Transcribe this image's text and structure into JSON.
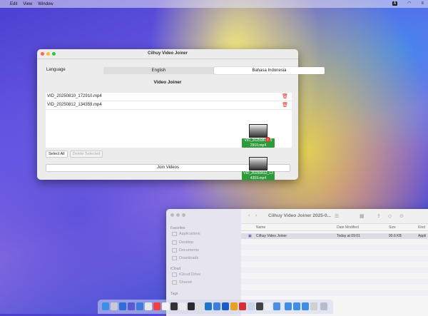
{
  "menubar": {
    "items": [
      "Edit",
      "View",
      "Window"
    ],
    "input_badge": "A"
  },
  "window": {
    "title": "Cilhuy Video Joiner",
    "language_label": "Language",
    "languages": [
      "English",
      "Bahasa Indonesia"
    ],
    "section_title": "Video Joiner",
    "files": [
      "VID_20250810_172910.mp4",
      "VID_20250812_134359.mp4"
    ],
    "select_all": "Select All",
    "delete_selected": "Delete Selected",
    "join": "Join Videos"
  },
  "drag_items": [
    {
      "label_line1": "VID_2025081015",
      "label_line2": "2910.mp4",
      "count": "2"
    },
    {
      "label_line1": "VID_20250812_13",
      "label_line2": "4359.mp4"
    }
  ],
  "finder": {
    "title": "Cilhuy Video Joiner 2025-0...",
    "favorites_label": "Favorites",
    "favorites": [
      "Applications",
      "Desktop",
      "Documents",
      "Downloads"
    ],
    "icloud_label": "iCloud",
    "icloud": [
      "iCloud Drive",
      "Shared"
    ],
    "tags_label": "Tags",
    "columns": [
      "Name",
      "Date Modified",
      "Size",
      "Kind"
    ],
    "row": {
      "name": "Cilhuy Video Joiner",
      "date": "Today at 09:01",
      "size": "90.6 KB",
      "kind": "Appli"
    }
  },
  "colors": {
    "close": "#ff5f57",
    "minimize": "#febc2e",
    "zoom": "#28c840",
    "drag_label": "#2e9a3c",
    "trash": "#e03030"
  }
}
